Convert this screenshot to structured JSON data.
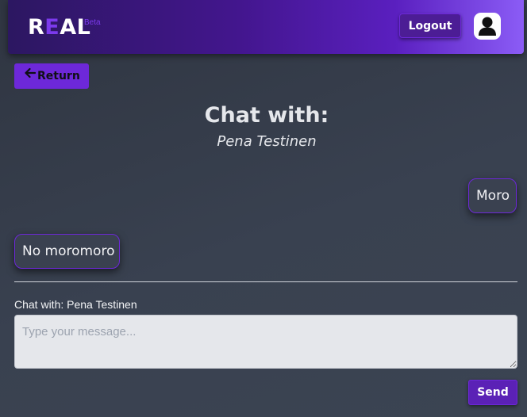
{
  "header": {
    "logo_first": "R",
    "logo_accent": "E",
    "logo_rest": "AL",
    "beta_label": "Beta",
    "logout_label": "Logout",
    "avatar_icon": "user-icon"
  },
  "nav": {
    "return_label": "Return",
    "return_icon": "arrow-left-icon"
  },
  "chat": {
    "title": "Chat with:",
    "partner_name": "Pena Testinen",
    "messages": [
      {
        "text": "Moro",
        "direction": "sent"
      },
      {
        "text": "No moromoro",
        "direction": "received"
      }
    ]
  },
  "composer": {
    "label": "Chat with: Pena Testinen",
    "placeholder": "Type your message...",
    "value": "",
    "send_label": "Send"
  },
  "colors": {
    "accent": "#6d28d9",
    "header_start": "#2c1761",
    "header_end": "#8b5cf6",
    "background": "#394150"
  }
}
